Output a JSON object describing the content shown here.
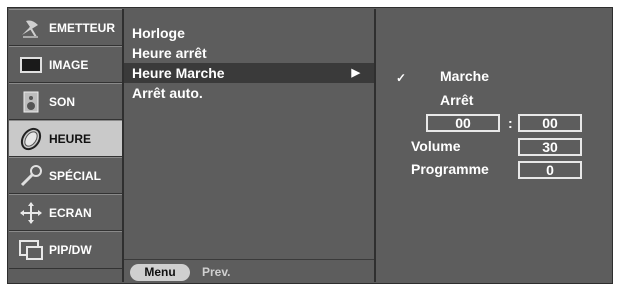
{
  "sidebar": {
    "items": [
      {
        "label": "EMETTEUR",
        "icon": "satellite-dish-icon",
        "active": false
      },
      {
        "label": "IMAGE",
        "icon": "monitor-icon",
        "active": false
      },
      {
        "label": "SON",
        "icon": "speaker-icon",
        "active": false
      },
      {
        "label": "HEURE",
        "icon": "clock-icon",
        "active": true
      },
      {
        "label": "SPÉCIAL",
        "icon": "key-icon",
        "active": false
      },
      {
        "label": "ECRAN",
        "icon": "move-arrows-icon",
        "active": false
      },
      {
        "label": "PIP/DW",
        "icon": "pip-windows-icon",
        "active": false
      }
    ]
  },
  "submenu": {
    "items": [
      {
        "label": "Horloge",
        "active": false
      },
      {
        "label": "Heure arrêt",
        "active": false
      },
      {
        "label": "Heure Marche",
        "active": true
      },
      {
        "label": "Arrêt auto.",
        "active": false
      }
    ],
    "active_arrow": "▶"
  },
  "footer": {
    "menu_label": "Menu",
    "prev_label": "Prev."
  },
  "settings": {
    "check_mark": "✓",
    "on_label": "Marche",
    "off_label": "Arrêt",
    "hour": "00",
    "separator": ":",
    "minute": "00",
    "volume_label": "Volume",
    "volume_value": "30",
    "program_label": "Programme",
    "program_value": "0"
  },
  "colors": {
    "background": "#5d5d5d",
    "active_sidebar": "#c9c9c9",
    "active_submenu": "#3a3a3a"
  }
}
